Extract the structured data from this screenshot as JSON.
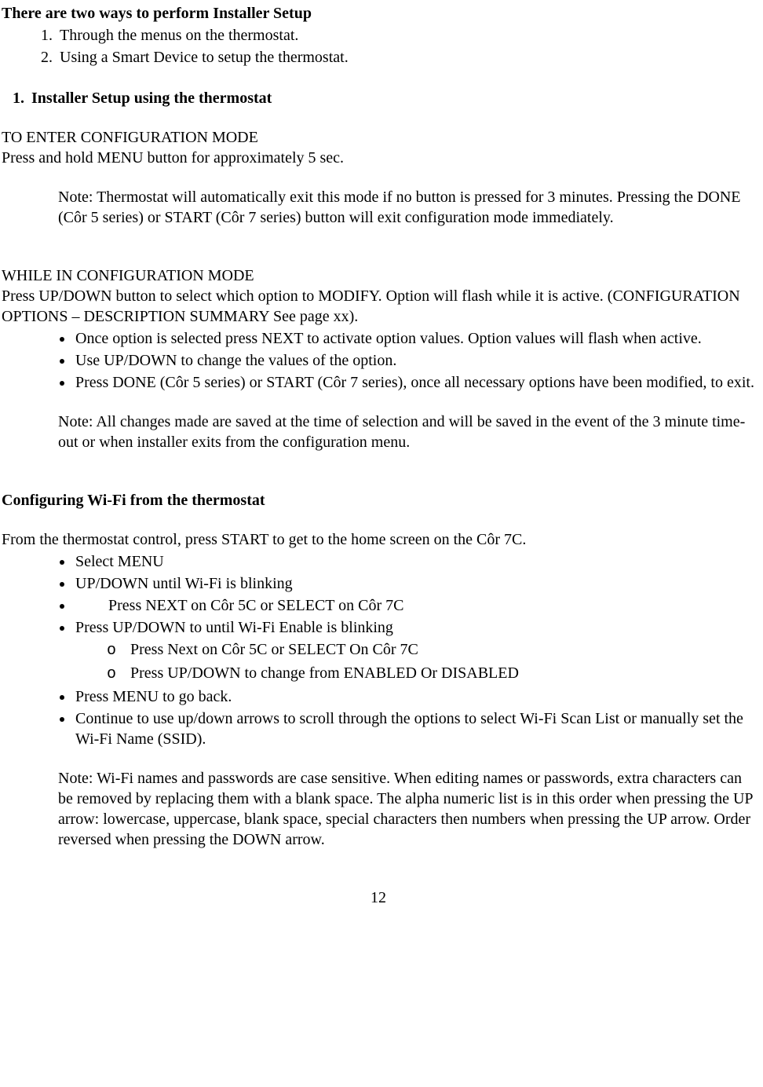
{
  "heading1": "There are two ways to perform Installer Setup",
  "ways": {
    "item1": "Through the menus on the thermostat.",
    "item2": "Using a Smart Device to setup the thermostat."
  },
  "section1_title": "Installer Setup using the thermostat",
  "config_enter_title": "TO ENTER CONFIGURATION MODE",
  "config_enter_body": "Press and hold MENU button for approximately 5 sec.",
  "note1": "Note: Thermostat will automatically exit this mode if no button is pressed for 3 minutes. Pressing the DONE (Côr 5 series) or START (Côr 7 series) button will exit configuration mode immediately.",
  "config_while_title": "WHILE IN CONFIGURATION MODE",
  "config_while_body": "Press UP/DOWN button to select which option to MODIFY. Option will flash while it is active. (CONFIGURATION OPTIONS – DESCRIPTION SUMMARY See page xx).",
  "config_bullets": {
    "b1": "Once option is selected press NEXT to activate option values. Option values will flash when active.",
    "b2": "Use UP/DOWN to change the values of the option.",
    "b3": "Press DONE (Côr 5 series) or START (Côr 7 series), once all necessary options have been modified, to exit."
  },
  "note2": "Note: All changes made are saved at the time of selection and will be saved in the event of the 3 minute time-out or when installer exits from the configuration menu.",
  "wifi_heading": "Configuring Wi-Fi from the thermostat",
  "wifi_intro": "From the thermostat control, press START to get to the home screen on the Côr 7C.",
  "wifi": {
    "b1": "Select MENU",
    "b2": "UP/DOWN until Wi-Fi is blinking",
    "b3": "Press NEXT on Côr 5C or SELECT on Côr 7C",
    "b4": "Press UP/DOWN to  until Wi-Fi Enable is blinking",
    "b4_sub1": "Press Next on Côr 5C or SELECT On Côr 7C",
    "b4_sub2": "Press UP/DOWN to change from ENABLED Or DISABLED",
    "b5": "Press MENU to go back.",
    "b6": "Continue to use up/down arrows to scroll through the options to select Wi-Fi Scan List or manually set the Wi-Fi Name (SSID)."
  },
  "note3": "Note: Wi-Fi names and passwords are case sensitive. When editing names or passwords, extra characters can be removed by replacing them with a blank space. The alpha numeric list is in this order when pressing the UP arrow: lowercase, uppercase, blank space, special characters then numbers when pressing the UP arrow. Order reversed when pressing the DOWN arrow.",
  "page_number": "12"
}
